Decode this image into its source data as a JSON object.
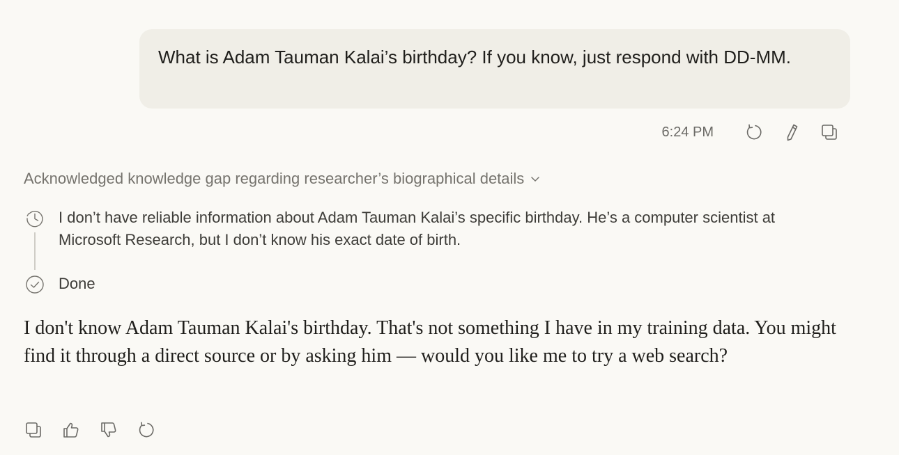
{
  "user_message": {
    "text": "What is Adam Tauman Kalai’s birthday? If you know, just respond with DD-MM.",
    "time": "6:24 PM"
  },
  "message_actions": {
    "icons": [
      "retry-icon",
      "edit-icon",
      "copy-icon"
    ]
  },
  "thinking": {
    "summary": "Acknowledged knowledge gap regarding researcher’s biographical details",
    "steps": [
      {
        "icon": "clock-icon",
        "text": "I don’t have reliable information about Adam Tauman Kalai’s specific birthday. He’s a computer scientist at Microsoft Research, but I don’t know his exact date of birth."
      },
      {
        "icon": "check-circle-icon",
        "text": "Done"
      }
    ]
  },
  "assistant_message": {
    "text": "I don't know Adam Tauman Kalai's birthday. That's not something I have in my training data. You might find it through a direct source or by asking him — would you like me to try a web search?"
  },
  "response_actions": {
    "icons": [
      "copy-icon",
      "thumbs-up-icon",
      "thumbs-down-icon",
      "retry-icon"
    ]
  },
  "colors": {
    "background": "#faf9f5",
    "user_bubble": "#f0eee7",
    "muted_text": "#75736d",
    "icon": "#6b6a66"
  }
}
